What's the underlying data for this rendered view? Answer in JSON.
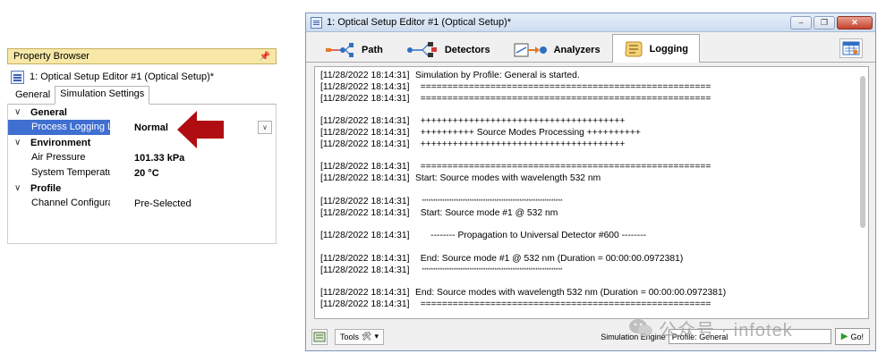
{
  "property_browser": {
    "title": "Property Browser",
    "pin_glyph": "📌",
    "source": "1: Optical Setup Editor #1 (Optical Setup)*",
    "tabs": [
      "General",
      "Simulation Settings"
    ],
    "active_tab": "Simulation Settings",
    "categories": [
      {
        "name": "General",
        "rows": [
          {
            "name": "Process Logging Level",
            "value": "Normal",
            "selected": true
          }
        ]
      },
      {
        "name": "Environment",
        "rows": [
          {
            "name": "Air Pressure",
            "value": "101.33 kPa"
          },
          {
            "name": "System Temperature",
            "value": "20 °C"
          }
        ]
      },
      {
        "name": "Profile",
        "rows": [
          {
            "name": "Channel Configuration",
            "value": "Pre-Selected"
          }
        ]
      }
    ],
    "highlight_color": "#3f6fd1",
    "arrow_color": "#b00d12"
  },
  "editor": {
    "title": "1: Optical Setup Editor #1 (Optical Setup)*",
    "window_buttons": {
      "minimize": "–",
      "restore": "❐",
      "close": "✕"
    },
    "tabs": [
      {
        "label": "Path",
        "icon": "path-icon"
      },
      {
        "label": "Detectors",
        "icon": "detectors-icon"
      },
      {
        "label": "Analyzers",
        "icon": "analyzers-icon"
      },
      {
        "label": "Logging",
        "icon": "logging-icon",
        "active": true
      }
    ],
    "log": [
      {
        "ts": "[11/28/2022 18:14:31]",
        "msg": "Simulation by Profile: General is started."
      },
      {
        "ts": "[11/28/2022 18:14:31]",
        "msg": "  ======================================================"
      },
      {
        "ts": "[11/28/2022 18:14:31]",
        "msg": "  ======================================================"
      },
      {
        "blank": true
      },
      {
        "ts": "[11/28/2022 18:14:31]",
        "msg": "  ++++++++++++++++++++++++++++++++++++++"
      },
      {
        "ts": "[11/28/2022 18:14:31]",
        "msg": "  ++++++++++ Source Modes Processing ++++++++++"
      },
      {
        "ts": "[11/28/2022 18:14:31]",
        "msg": "  ++++++++++++++++++++++++++++++++++++++"
      },
      {
        "blank": true
      },
      {
        "ts": "[11/28/2022 18:14:31]",
        "msg": "  ======================================================"
      },
      {
        "ts": "[11/28/2022 18:14:31]",
        "msg": "Start: Source modes with wavelength 532 nm"
      },
      {
        "blank": true
      },
      {
        "ts": "[11/28/2022 18:14:31]",
        "msg": "    **************************************************************",
        "small": true
      },
      {
        "ts": "[11/28/2022 18:14:31]",
        "msg": "  Start: Source mode #1 @ 532 nm"
      },
      {
        "blank": true
      },
      {
        "ts": "[11/28/2022 18:14:31]",
        "msg": "      -------- Propagation to Universal Detector #600 --------"
      },
      {
        "blank": true
      },
      {
        "ts": "[11/28/2022 18:14:31]",
        "msg": "  End: Source mode #1 @ 532 nm (Duration = 00:00:00.0972381)"
      },
      {
        "ts": "[11/28/2022 18:14:31]",
        "msg": "    **************************************************************",
        "small": true
      },
      {
        "blank": true
      },
      {
        "ts": "[11/28/2022 18:14:31]",
        "msg": "End: Source modes with wavelength 532 nm (Duration = 00:00:00.0972381)"
      },
      {
        "ts": "[11/28/2022 18:14:31]",
        "msg": "  ======================================================"
      }
    ],
    "statusbar": {
      "tools_label": "Tools",
      "engine_label": "Simulation Engine",
      "engine_value": "Profile: General",
      "go_label": "Go!"
    }
  },
  "watermark": {
    "text": "公众号 · infotek"
  }
}
